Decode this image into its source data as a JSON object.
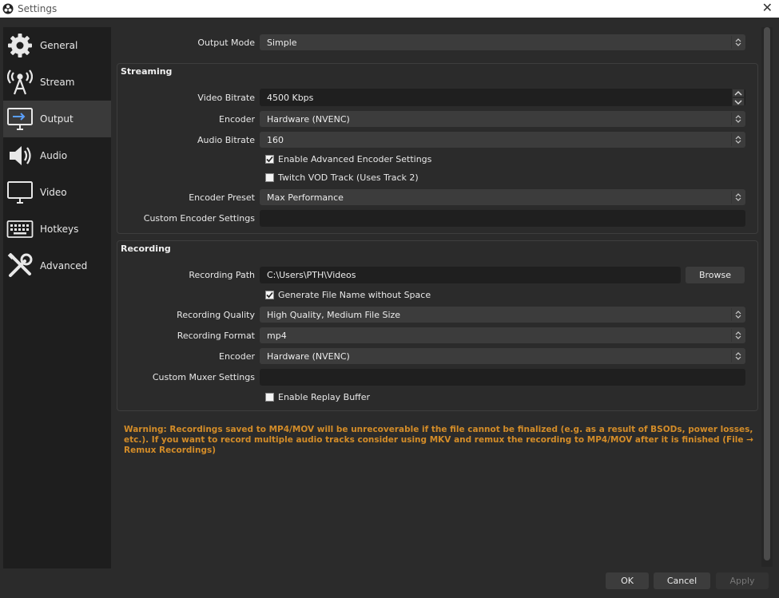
{
  "window": {
    "title": "Settings",
    "close_glyph": "✕"
  },
  "sidebar": {
    "items": [
      {
        "label": "General",
        "icon": "gear-icon"
      },
      {
        "label": "Stream",
        "icon": "broadcast-tower-icon"
      },
      {
        "label": "Output",
        "icon": "monitor-output-icon",
        "active": true
      },
      {
        "label": "Audio",
        "icon": "speaker-icon"
      },
      {
        "label": "Video",
        "icon": "monitor-icon"
      },
      {
        "label": "Hotkeys",
        "icon": "keyboard-icon"
      },
      {
        "label": "Advanced",
        "icon": "tools-icon"
      }
    ]
  },
  "output_mode": {
    "label": "Output Mode",
    "value": "Simple"
  },
  "streaming": {
    "title": "Streaming",
    "video_bitrate": {
      "label": "Video Bitrate",
      "value": "4500 Kbps"
    },
    "encoder": {
      "label": "Encoder",
      "value": "Hardware (NVENC)"
    },
    "audio_bitrate": {
      "label": "Audio Bitrate",
      "value": "160"
    },
    "enable_advanced": {
      "label": "Enable Advanced Encoder Settings",
      "checked": true
    },
    "twitch_vod": {
      "label": "Twitch VOD Track (Uses Track 2)",
      "checked": false
    },
    "encoder_preset": {
      "label": "Encoder Preset",
      "value": "Max Performance"
    },
    "custom_encoder": {
      "label": "Custom Encoder Settings",
      "value": ""
    }
  },
  "recording": {
    "title": "Recording",
    "path": {
      "label": "Recording Path",
      "value": "C:\\Users\\PTH\\Videos"
    },
    "browse_label": "Browse",
    "gen_filename": {
      "label": "Generate File Name without Space",
      "checked": true
    },
    "quality": {
      "label": "Recording Quality",
      "value": "High Quality, Medium File Size"
    },
    "format": {
      "label": "Recording Format",
      "value": "mp4"
    },
    "encoder": {
      "label": "Encoder",
      "value": "Hardware (NVENC)"
    },
    "custom_muxer": {
      "label": "Custom Muxer Settings",
      "value": ""
    },
    "replay_buffer": {
      "label": "Enable Replay Buffer",
      "checked": false
    }
  },
  "warning": "Warning: Recordings saved to MP4/MOV will be unrecoverable if the file cannot be finalized (e.g. as a result of BSODs, power losses, etc.). If you want to record multiple audio tracks consider using MKV and remux the recording to MP4/MOV after it is finished (File → Remux Recordings)",
  "footer": {
    "ok": "OK",
    "cancel": "Cancel",
    "apply": "Apply"
  },
  "colors": {
    "warning": "#d38c28",
    "background": "#2b2b2b",
    "sidebar": "#1e1e1e"
  }
}
